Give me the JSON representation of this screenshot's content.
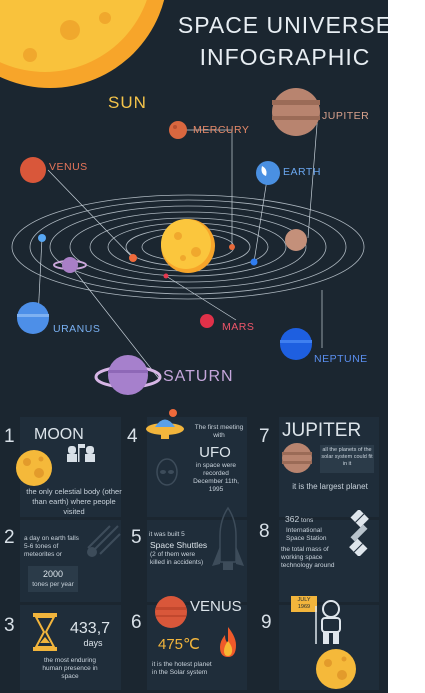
{
  "title": {
    "line1": "SPACE UNIVERSE",
    "line2": "INFOGRAPHIC"
  },
  "planets": {
    "sun": "SUN",
    "mercury": "MERCURY",
    "jupiter": "JUPITER",
    "venus": "VENUS",
    "earth": "EARTH",
    "uranus": "URANUS",
    "mars": "MARS",
    "neptune": "NEPTUNE",
    "saturn": "SATURN"
  },
  "facts": [
    {
      "num": "1",
      "heading": "MOON",
      "text": "the only celestial body (other than earth) where people visited"
    },
    {
      "num": "2",
      "text": "a day on earth falls 5-6 tones of meteorites or",
      "value": "2000",
      "unit": "tones per year"
    },
    {
      "num": "3",
      "value": "433,7",
      "unit": "days",
      "text": "the most enduring human presence in space"
    },
    {
      "num": "4",
      "intro": "The first meeting with",
      "heading": "UFO",
      "text": "in space were recorded December 11th, 1995"
    },
    {
      "num": "5",
      "intro": "it was built 5",
      "heading": "Space Shuttles",
      "text": "(2 of them were killed in accidents)"
    },
    {
      "num": "6",
      "heading": "VENUS",
      "value": "475℃",
      "text": "it is the hotest planet in the Solar system"
    },
    {
      "num": "7",
      "heading": "JUPITER",
      "note": "all the planets of the solar system could fit in it",
      "text": "it is the largest planet"
    },
    {
      "num": "8",
      "value": "362",
      "unit": "tons",
      "intro": "International Space Station",
      "text": "the total mass of working space technology around"
    },
    {
      "num": "9",
      "sign": "JULY 1969"
    }
  ],
  "colors": {
    "bg": "#1b2630",
    "panel": "#1f2d3a",
    "sun": "#f9c23c",
    "text": "#cfd8e0"
  }
}
